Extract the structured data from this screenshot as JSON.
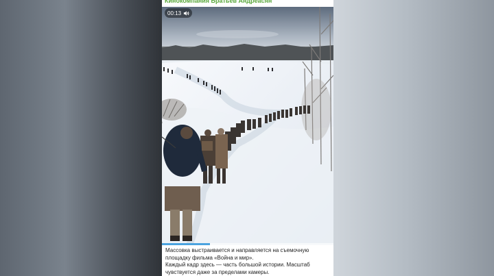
{
  "post": {
    "channel_name": "Кинокомпания Братьев Андреасян",
    "caption_line1": "Массовка выстраивается и направляется на съемочную площадку фильма «Война и мир».",
    "caption_line2": "Каждый кадр здесь — часть большой истории. Масштаб чувствуется даже за пределами камеры."
  },
  "video": {
    "timestamp": "00:13",
    "volume_icon": "speaker-icon",
    "progress": 0.28
  },
  "colors": {
    "channel_name": "#5aa83c",
    "progress_fill": "#4aa3df"
  }
}
